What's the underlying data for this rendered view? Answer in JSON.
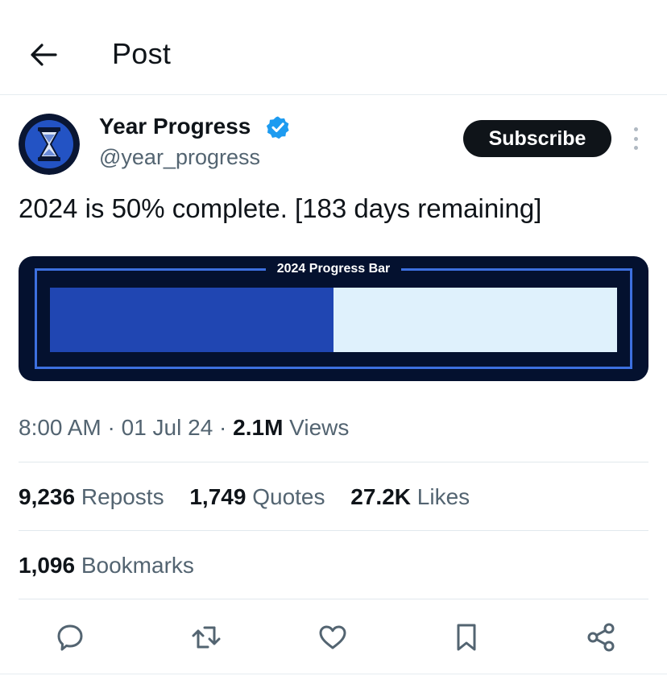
{
  "header": {
    "back_icon": "arrow-left-icon",
    "title": "Post"
  },
  "post": {
    "author": {
      "name": "Year Progress",
      "handle": "@year_progress",
      "verified": true,
      "avatar_icon": "hourglass-icon"
    },
    "subscribe_label": "Subscribe",
    "more_icon": "more-vertical-icon",
    "text": "2024 is 50% complete. [183 days remaining]",
    "media": {
      "label": "2024 Progress Bar",
      "progress": 0.5
    },
    "meta": {
      "time": "8:00 AM",
      "separator": " · ",
      "date": "01 Jul 24",
      "views_count": "2.1M",
      "views_label": " Views"
    },
    "stats": {
      "reposts_count": "9,236",
      "reposts_label": " Reposts",
      "quotes_count": "1,749",
      "quotes_label": " Quotes",
      "likes_count": "27.2K",
      "likes_label": " Likes",
      "bookmarks_count": "1,096",
      "bookmarks_label": " Bookmarks"
    },
    "actions": [
      "reply-icon",
      "repost-icon",
      "like-icon",
      "bookmark-icon",
      "share-icon"
    ]
  },
  "colors": {
    "text_primary": "#0f1419",
    "text_secondary": "#536471",
    "verified_blue": "#1d9bf0",
    "progress_card_bg": "#04112f",
    "progress_frame": "#3d70e0",
    "progress_fill": "#2046b2",
    "progress_track": "#dff1fc",
    "subscribe_bg": "#0f1419"
  }
}
